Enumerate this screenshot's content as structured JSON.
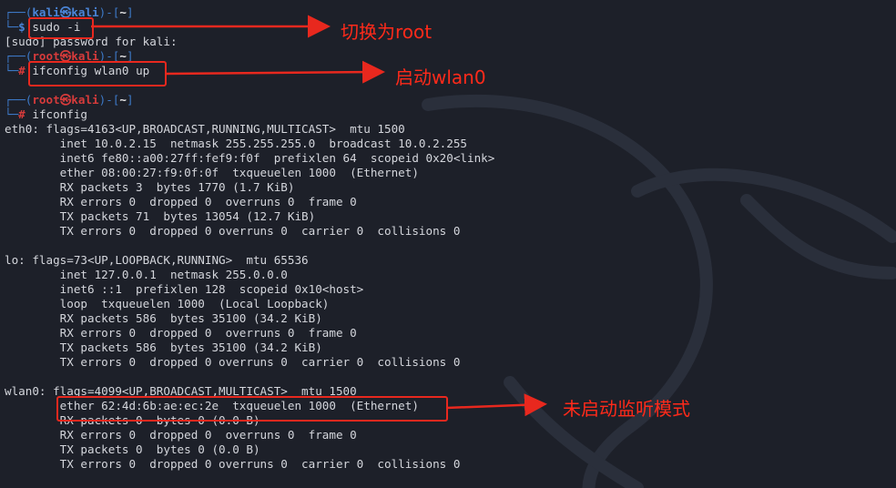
{
  "prompt_user": "kali",
  "prompt_root": "root",
  "prompt_host": "kali",
  "prompt_cwd": "~",
  "dollar": "$",
  "hash": "#",
  "commands": {
    "sudo": "sudo -i",
    "ifup": "ifconfig wlan0 up",
    "ifconfig": "ifconfig"
  },
  "sudo_prompt": "[sudo] password for kali:",
  "eth0": [
    "eth0: flags=4163<UP,BROADCAST,RUNNING,MULTICAST>  mtu 1500",
    "        inet 10.0.2.15  netmask 255.255.255.0  broadcast 10.0.2.255",
    "        inet6 fe80::a00:27ff:fef9:f0f  prefixlen 64  scopeid 0x20<link>",
    "        ether 08:00:27:f9:0f:0f  txqueuelen 1000  (Ethernet)",
    "        RX packets 3  bytes 1770 (1.7 KiB)",
    "        RX errors 0  dropped 0  overruns 0  frame 0",
    "        TX packets 71  bytes 13054 (12.7 KiB)",
    "        TX errors 0  dropped 0 overruns 0  carrier 0  collisions 0"
  ],
  "lo": [
    "lo: flags=73<UP,LOOPBACK,RUNNING>  mtu 65536",
    "        inet 127.0.0.1  netmask 255.0.0.0",
    "        inet6 ::1  prefixlen 128  scopeid 0x10<host>",
    "        loop  txqueuelen 1000  (Local Loopback)",
    "        RX packets 586  bytes 35100 (34.2 KiB)",
    "        RX errors 0  dropped 0  overruns 0  frame 0",
    "        TX packets 586  bytes 35100 (34.2 KiB)",
    "        TX errors 0  dropped 0 overruns 0  carrier 0  collisions 0"
  ],
  "wlan0": [
    "wlan0: flags=4099<UP,BROADCAST,MULTICAST>  mtu 1500",
    "        ether 62:4d:6b:ae:ec:2e  txqueuelen 1000  (Ethernet)",
    "        RX packets 0  bytes 0 (0.0 B)",
    "        RX errors 0  dropped 0  overruns 0  frame 0",
    "        TX packets 0  bytes 0 (0.0 B)",
    "        TX errors 0  dropped 0 overruns 0  carrier 0  collisions 0"
  ],
  "annotations": {
    "switch_root": "切换为root",
    "start_wlan": "启动wlan0",
    "not_monitor": "未启动监听模式"
  },
  "colors": {
    "annotation": "#e8281e",
    "background": "#1d2029",
    "kali_prompt": "#4a84d6",
    "root_prompt": "#d63b3b"
  }
}
